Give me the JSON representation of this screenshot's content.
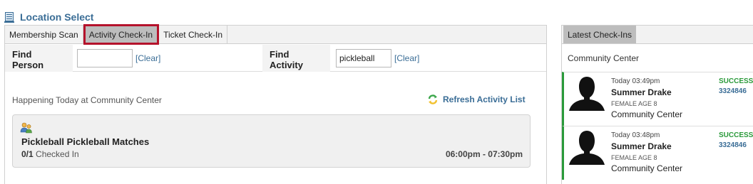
{
  "header": {
    "title": "Location Select",
    "icon": "location-icon"
  },
  "tabs": [
    {
      "label": "Membership Scan",
      "active": false
    },
    {
      "label": "Activity Check-In",
      "active": true
    },
    {
      "label": "Ticket Check-In",
      "active": false
    }
  ],
  "find_person": {
    "label": "Find Person",
    "value": "",
    "clear_label": "[Clear]"
  },
  "find_activity": {
    "label": "Find Activity",
    "value": "pickleball",
    "clear_label": "[Clear]"
  },
  "happening": {
    "text": "Happening Today at Community Center"
  },
  "refresh": {
    "label": "Refresh Activity List",
    "icon": "refresh-icon"
  },
  "activities": [
    {
      "name": "Pickleball Pickleball Matches",
      "checked_count": "0/1",
      "checked_label": "Checked In",
      "time": "06:00pm - 07:30pm",
      "icon": "people-icon"
    }
  ],
  "right_panel": {
    "tab_label": "Latest Check-Ins",
    "location": "Community Center",
    "checkins": [
      {
        "time": "Today 03:49pm",
        "name": "Summer Drake",
        "details": "FEMALE AGE 8",
        "location": "Community Center",
        "status": "SUCCESS",
        "number": "3324846"
      },
      {
        "time": "Today 03:48pm",
        "name": "Summer Drake",
        "details": "FEMALE AGE 8",
        "location": "Community Center",
        "status": "SUCCESS",
        "number": "3324846"
      }
    ]
  },
  "colors": {
    "accent": "#3a6d96",
    "success": "#2a9a3a",
    "active_tab_outline": "#b5122b"
  }
}
